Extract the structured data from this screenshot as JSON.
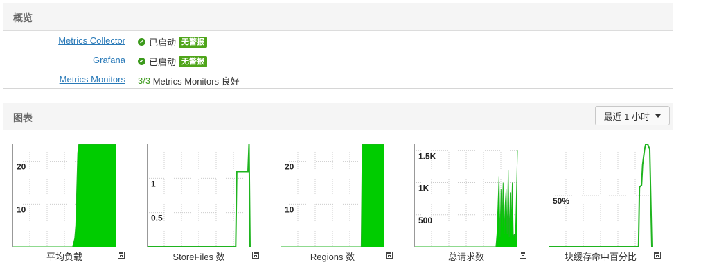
{
  "overview": {
    "title": "概览",
    "services": [
      {
        "name": "Metrics Collector",
        "status": "已启动",
        "alert": "无警报"
      },
      {
        "name": "Grafana",
        "status": "已启动",
        "alert": "无警报"
      }
    ],
    "monitors": {
      "name": "Metrics Monitors",
      "count": "3/3",
      "text": "Metrics Monitors 良好"
    }
  },
  "charts_panel": {
    "title": "图表",
    "range_label": "最近 1 小时"
  },
  "colors": {
    "series": "#00cc00",
    "grid": "#cccccc",
    "axis": "#999999"
  },
  "chart_data": [
    {
      "type": "area",
      "title": "平均负载",
      "ytick_labels": [
        "20",
        "10"
      ],
      "ylim": [
        0,
        24
      ],
      "x": [
        0,
        58,
        60,
        61,
        62,
        63,
        64,
        100
      ],
      "y": [
        0,
        0,
        2,
        5,
        14,
        22,
        24,
        24
      ]
    },
    {
      "type": "line",
      "title": "StoreFiles 数",
      "ytick_labels": [
        "1",
        "0.5"
      ],
      "ylim": [
        0,
        1.5
      ],
      "x": [
        0,
        86,
        87,
        98,
        99,
        100
      ],
      "y": [
        0,
        0,
        1.1,
        1.1,
        1.5,
        0
      ]
    },
    {
      "type": "area",
      "title": "Regions 数",
      "ytick_labels": [
        "20",
        "10"
      ],
      "ylim": [
        0,
        24
      ],
      "x": [
        0,
        78,
        79,
        100
      ],
      "y": [
        0,
        0,
        24,
        24
      ]
    },
    {
      "type": "area",
      "title": "总请求数",
      "ytick_labels": [
        "1.5K",
        "1K",
        "500"
      ],
      "ylim": [
        0,
        1600
      ],
      "x": [
        0,
        79,
        80,
        82,
        83,
        84,
        85,
        86,
        87,
        88,
        89,
        90,
        91,
        92,
        93,
        94,
        95,
        96,
        97,
        98,
        100
      ],
      "y": [
        0,
        0,
        200,
        1100,
        150,
        900,
        300,
        1000,
        200,
        650,
        900,
        200,
        1200,
        150,
        850,
        400,
        1000,
        150,
        200,
        100,
        1500
      ]
    },
    {
      "type": "line",
      "title": "块缓存命中百分比",
      "ytick_labels": [
        "50%"
      ],
      "ylim": [
        0,
        100
      ],
      "x": [
        0,
        87,
        88,
        90,
        91,
        92,
        93,
        94,
        96,
        98,
        100
      ],
      "y": [
        0,
        0,
        58,
        60,
        80,
        88,
        95,
        100,
        100,
        95,
        0
      ]
    }
  ]
}
